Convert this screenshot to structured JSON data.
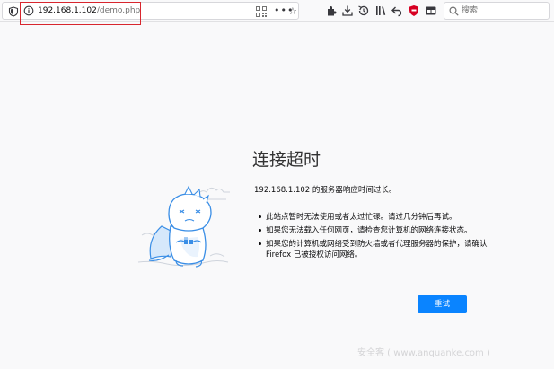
{
  "urlbar": {
    "host": "192.168.1.102",
    "path": "/demo.php"
  },
  "search": {
    "placeholder": "搜索"
  },
  "error": {
    "title": "连接超时",
    "lead": "192.168.1.102 的服务器响应时间过长。",
    "items": [
      "此站点暂时无法使用或者太过忙碌。请过几分钟后再试。",
      "如果您无法载入任何网页，请检查您计算机的网络连接状态。",
      "如果您的计算机或网络受到防火墙或者代理服务器的保护，请确认 Firefox 已被授权访问网络。"
    ],
    "retry_label": "重试"
  },
  "watermark": "安全客 ( www.anquanke.com )",
  "colors": {
    "accent": "#0a84ff",
    "highlight": "#d8262e",
    "background": "#f9f9fa"
  },
  "icons": [
    "shield-icon",
    "info-icon",
    "qr-code-icon",
    "more-icon",
    "bookmark-star-icon",
    "extensions-icon",
    "downloads-icon",
    "history-icon",
    "library-icon",
    "back-icon",
    "addon-shield-icon",
    "container-icon",
    "menu-icon",
    "search-icon"
  ]
}
